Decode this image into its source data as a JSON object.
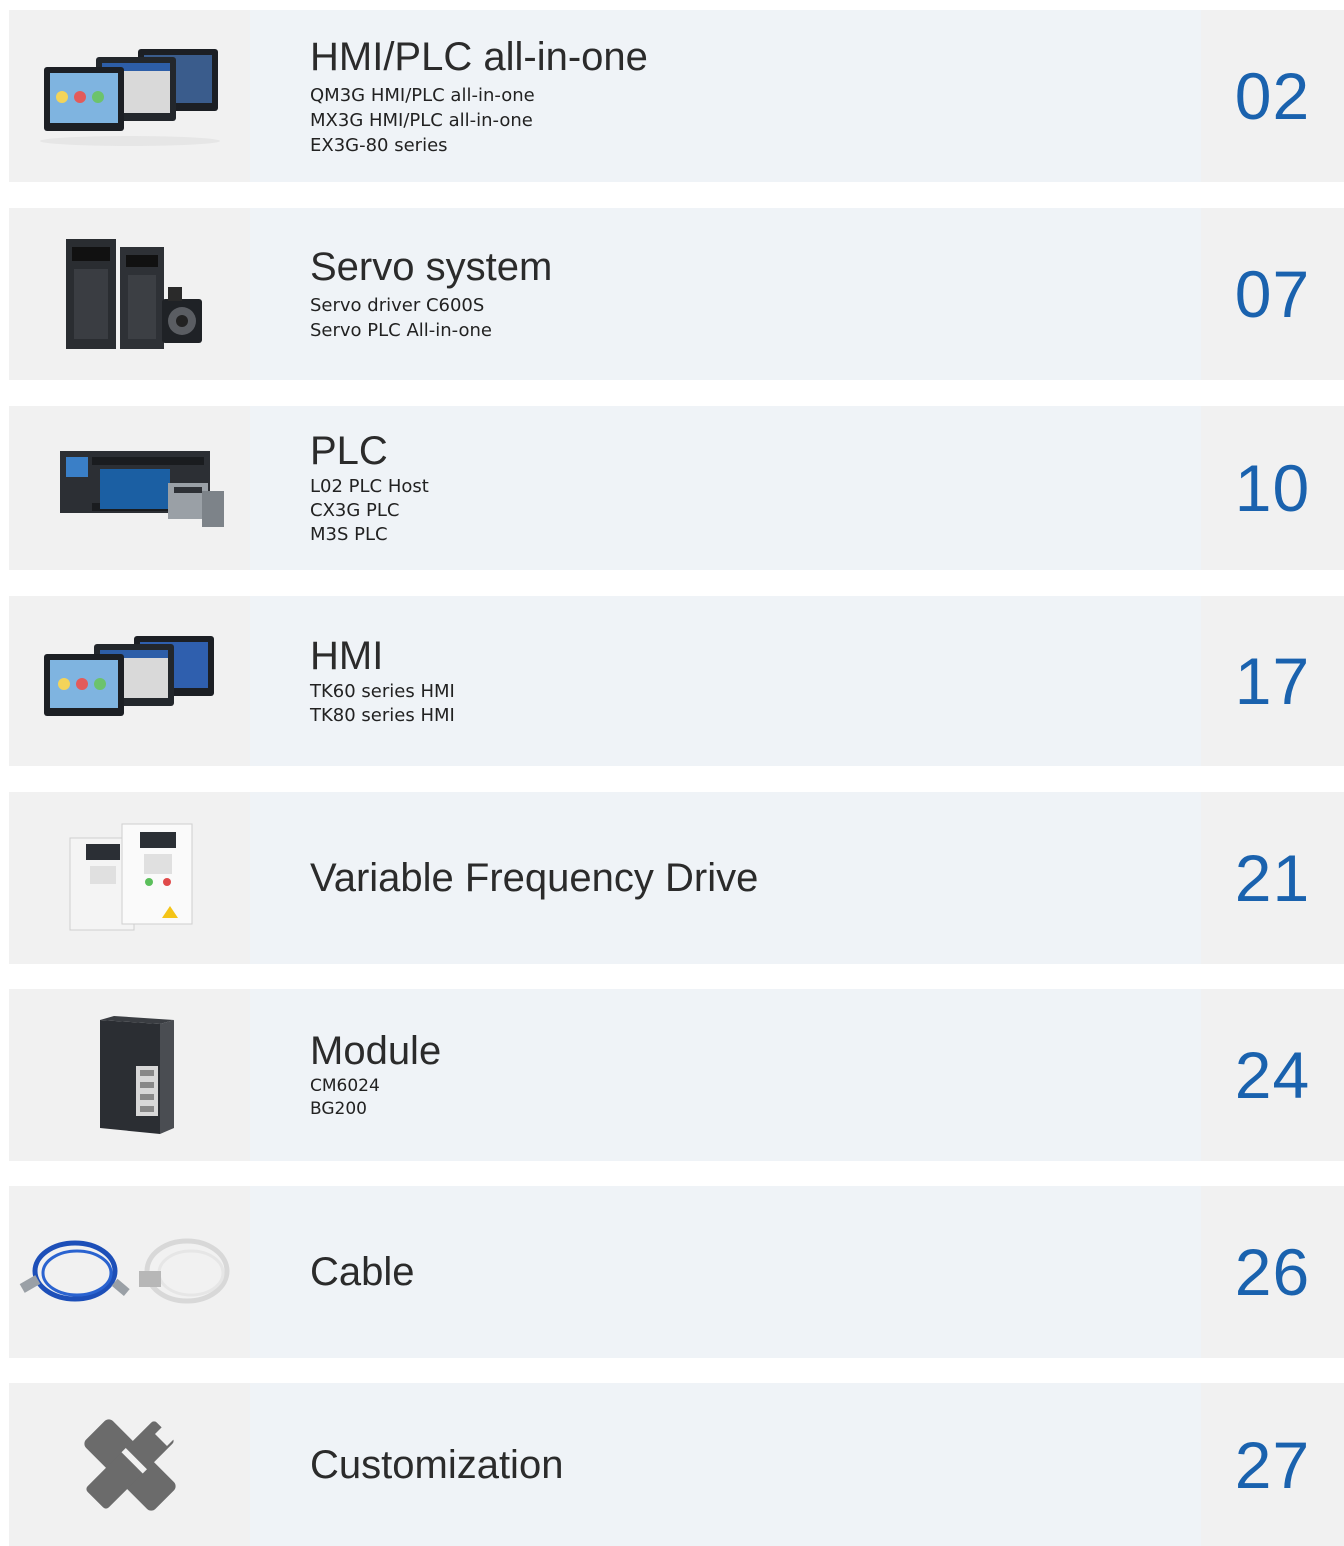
{
  "sections": [
    {
      "title": "HMI/PLC all-in-one",
      "items": [
        "QM3G HMI/PLC all-in-one",
        "MX3G HMI/PLC all-in-one",
        "EX3G-80 series"
      ],
      "page": "02",
      "icon": "hmi-plc-product-image"
    },
    {
      "title": "Servo system",
      "items": [
        "Servo driver C600S",
        "Servo PLC All-in-one"
      ],
      "page": "07",
      "icon": "servo-product-image"
    },
    {
      "title": "PLC",
      "items": [
        "L02 PLC Host",
        "CX3G PLC",
        "M3S PLC"
      ],
      "page": "10",
      "icon": "plc-product-image"
    },
    {
      "title": "HMI",
      "items": [
        "TK60 series HMI",
        "TK80 series HMI"
      ],
      "page": "17",
      "icon": "hmi-product-image"
    },
    {
      "title": "Variable Frequency Drive",
      "items": [],
      "page": "21",
      "icon": "vfd-product-image"
    },
    {
      "title": "Module",
      "items": [
        "CM6024",
        "BG200"
      ],
      "page": "24",
      "icon": "module-product-image"
    },
    {
      "title": "Cable",
      "items": [],
      "page": "26",
      "icon": "cable-product-image"
    },
    {
      "title": "Customization",
      "items": [],
      "page": "27",
      "icon": "customization-icon"
    }
  ],
  "colors": {
    "page_number": "#1a62ae",
    "thumb_bg": "#f1f1f1",
    "info_bg": "#eff3f7",
    "title": "#2b2b2b"
  }
}
